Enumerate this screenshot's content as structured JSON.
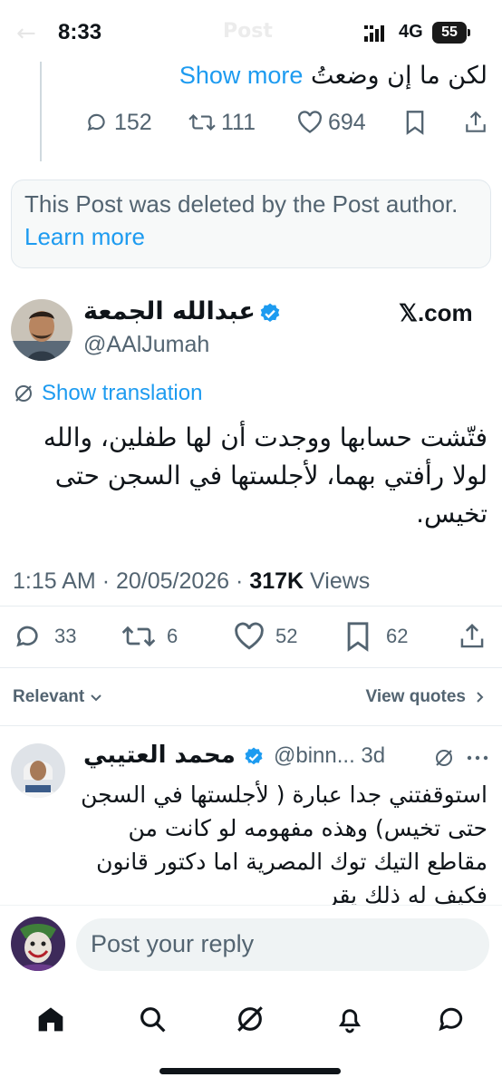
{
  "status_bar": {
    "time": "8:33",
    "network": "4G",
    "battery": "55",
    "ghost_title": "Post"
  },
  "previous_post": {
    "text": "لكن ما إن وضعتُ",
    "show_more": "Show more",
    "replies": "152",
    "reposts": "111",
    "likes": "694"
  },
  "deleted_post": {
    "text": "This Post was deleted by the Post author.",
    "learn_more": "Learn more"
  },
  "main_post": {
    "author_name": "عبدالله الجمعة",
    "handle": "@AAlJumah",
    "source": "𝕏.com",
    "show_translation": "Show translation",
    "body": "فتّشت حسابها ووجدت أن لها طفلين، والله لولا رأفتي بهما، لأجلستها في السجن حتى تخيس.",
    "time": "1:15 AM",
    "date": "20/05/2026",
    "views": "317K",
    "views_label": "Views",
    "replies": "33",
    "reposts": "6",
    "likes": "52",
    "bookmarks": "62"
  },
  "replies_header": {
    "sort": "Relevant",
    "view_quotes": "View quotes"
  },
  "reply": {
    "author_name": "محمد العتيبي",
    "handle": "@binn...",
    "age": "3d",
    "body": "استوقفتني جدا عبارة ( لأجلستها في السجن حتى تخيس) وهذه مفهومه لو كانت  من مقاطع   التيك توك المصرية اما دكتور قانون فكيف له ذلك يقر"
  },
  "compose": {
    "placeholder": "Post your reply"
  },
  "tabs": [
    "home-icon",
    "search-icon",
    "grok-icon",
    "notifications-icon",
    "messages-icon"
  ],
  "colors": {
    "accent": "#1d9bf0",
    "muted": "#536471",
    "text": "#0f1419"
  }
}
